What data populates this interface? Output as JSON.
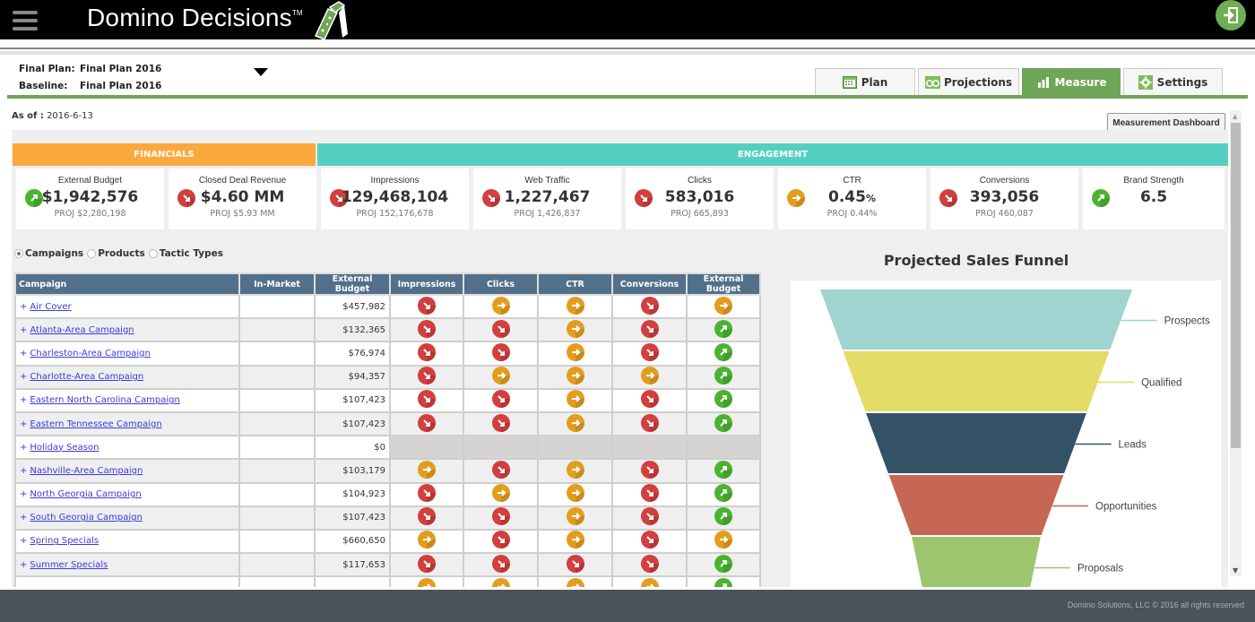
{
  "app": {
    "title": "Domino Decisions",
    "trademark": "TM",
    "menu_icon": "hamburger-icon",
    "exit_icon": "sign-in-icon"
  },
  "plan": {
    "final_plan_label": "Final Plan:",
    "final_plan_value": "Final Plan 2016",
    "baseline_label": "Baseline:",
    "baseline_value": "Final Plan 2016"
  },
  "tabs": [
    {
      "label": "Plan",
      "icon": "calendar-icon",
      "active": false
    },
    {
      "label": "Projections",
      "icon": "binoculars-icon",
      "active": false
    },
    {
      "label": "Measure",
      "icon": "bar-chart-icon",
      "active": true
    },
    {
      "label": "Settings",
      "icon": "gear-icon",
      "active": false
    }
  ],
  "as_of": {
    "label": "As of :",
    "value": "2016-6-13"
  },
  "measurement_dashboard_button": "Measurement Dashboard",
  "colors": {
    "accent_green": "#6fa557",
    "financials": "#fba93c",
    "engagement": "#55d0c0",
    "table_header": "#52708a",
    "status_up": "#4bb330",
    "status_down": "#d13f3f",
    "status_flat": "#e39d1e",
    "footer": "#4a5359"
  },
  "sections": {
    "financials": "FINANCIALS",
    "engagement": "ENGAGEMENT"
  },
  "kpis": [
    {
      "title": "External Budget",
      "value": "$1,942,576",
      "unit": "",
      "proj": "PROJ $2,280,198",
      "status": "up"
    },
    {
      "title": "Closed Deal Revenue",
      "value": "$4.60 MM",
      "unit": "",
      "proj": "PROJ $5.93 MM",
      "status": "down"
    },
    {
      "title": "Impressions",
      "value": "129,468,104",
      "unit": "",
      "proj": "PROJ 152,176,678",
      "status": "down"
    },
    {
      "title": "Web Traffic",
      "value": "1,227,467",
      "unit": "",
      "proj": "PROJ 1,426,837",
      "status": "down"
    },
    {
      "title": "Clicks",
      "value": "583,016",
      "unit": "",
      "proj": "PROJ 665,893",
      "status": "down"
    },
    {
      "title": "CTR",
      "value": "0.45",
      "unit": "%",
      "proj": "PROJ 0.44%",
      "status": "flat"
    },
    {
      "title": "Conversions",
      "value": "393,056",
      "unit": "",
      "proj": "PROJ 460,087",
      "status": "down"
    },
    {
      "title": "Brand Strength",
      "value": "6.5",
      "unit": "",
      "proj": "",
      "status": "up"
    }
  ],
  "view_options": [
    {
      "label": "Campaigns",
      "selected": true
    },
    {
      "label": "Products",
      "selected": false
    },
    {
      "label": "Tactic Types",
      "selected": false
    }
  ],
  "table": {
    "columns": [
      "Campaign",
      "In-Market",
      "External Budget",
      "Impressions",
      "Clicks",
      "CTR",
      "Conversions",
      "External Budget"
    ],
    "rows": [
      {
        "name": "Air Cover",
        "in_market": "",
        "budget": "$457,982",
        "status": [
          "down",
          "flat",
          "flat",
          "down",
          "flat"
        ]
      },
      {
        "name": "Atlanta-Area Campaign",
        "in_market": "",
        "budget": "$132,365",
        "status": [
          "down",
          "down",
          "flat",
          "down",
          "up"
        ]
      },
      {
        "name": "Charleston-Area Campaign",
        "in_market": "",
        "budget": "$76,974",
        "status": [
          "down",
          "down",
          "flat",
          "down",
          "up"
        ]
      },
      {
        "name": "Charlotte-Area Campaign",
        "in_market": "",
        "budget": "$94,357",
        "status": [
          "down",
          "flat",
          "flat",
          "flat",
          "up"
        ]
      },
      {
        "name": "Eastern North Carolina Campaign",
        "in_market": "",
        "budget": "$107,423",
        "status": [
          "down",
          "down",
          "flat",
          "down",
          "up"
        ]
      },
      {
        "name": "Eastern Tennessee Campaign",
        "in_market": "",
        "budget": "$107,423",
        "status": [
          "down",
          "down",
          "flat",
          "down",
          "up"
        ]
      },
      {
        "name": "Holiday Season",
        "in_market": "",
        "budget": "$0",
        "status": [
          "none",
          "none",
          "none",
          "none",
          "none"
        ]
      },
      {
        "name": "Nashville-Area Campaign",
        "in_market": "",
        "budget": "$103,179",
        "status": [
          "flat",
          "down",
          "flat",
          "down",
          "up"
        ]
      },
      {
        "name": "North Georgia Campaign",
        "in_market": "",
        "budget": "$104,923",
        "status": [
          "down",
          "flat",
          "flat",
          "down",
          "up"
        ]
      },
      {
        "name": "South Georgia Campaign",
        "in_market": "",
        "budget": "$107,423",
        "status": [
          "down",
          "down",
          "flat",
          "down",
          "up"
        ]
      },
      {
        "name": "Spring Specials",
        "in_market": "",
        "budget": "$660,650",
        "status": [
          "flat",
          "down",
          "flat",
          "down",
          "flat"
        ]
      },
      {
        "name": "Summer Specials",
        "in_market": "",
        "budget": "$117,653",
        "status": [
          "down",
          "down",
          "down",
          "down",
          "up"
        ]
      },
      {
        "name": "",
        "in_market": "",
        "budget": "",
        "status": [
          "flat",
          "flat",
          "flat",
          "flat",
          "up"
        ]
      }
    ]
  },
  "chart_data": {
    "type": "funnel",
    "title": "Projected Sales Funnel",
    "categories": [
      "Prospects",
      "Qualified",
      "Leads",
      "Opportunities",
      "Proposals"
    ],
    "colors": [
      "#9fd4d0",
      "#e3dc66",
      "#345366",
      "#c66654",
      "#9cc56e"
    ],
    "legend": "right"
  },
  "footer": {
    "text": "Domino Solutions, LLC © 2016 all rights reserved"
  }
}
